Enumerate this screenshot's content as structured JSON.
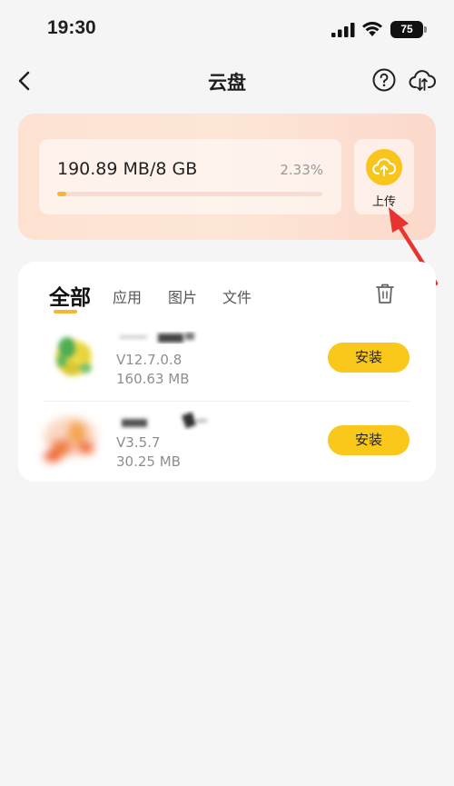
{
  "status_bar": {
    "time": "19:30",
    "battery": "75",
    "icons": [
      "signal-icon",
      "wifi-icon",
      "battery-icon"
    ]
  },
  "nav": {
    "title": "云盘",
    "icons": [
      "back-arrow-icon",
      "help-circle-icon",
      "cloud-sync-icon"
    ]
  },
  "storage": {
    "usage_text": "190.89 MB/8 GB",
    "usage_percent": "2.33%",
    "progress_fraction": 0.0233,
    "upload_label": "上传",
    "upload_icon": "cloud-upload-icon"
  },
  "tabs": [
    {
      "label": "全部",
      "active": true
    },
    {
      "label": "应用",
      "active": false
    },
    {
      "label": "图片",
      "active": false
    },
    {
      "label": "文件",
      "active": false
    }
  ],
  "apps": [
    {
      "version": "V12.7.0.8",
      "size": "160.63 MB",
      "action": "安装"
    },
    {
      "version": "V3.5.7",
      "size": "30.25 MB",
      "action": "安装"
    }
  ],
  "colors": {
    "accent": "#f9c81a",
    "progress": "#f5b731",
    "annotation_arrow": "#e8332f",
    "card_gradient_start": "#fde2d2",
    "background": "#f5f5f6"
  }
}
